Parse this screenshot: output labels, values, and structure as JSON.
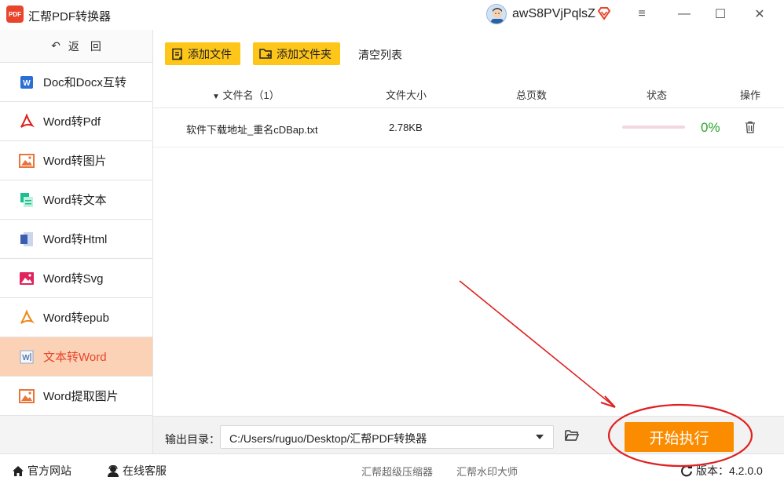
{
  "app": {
    "title": "汇帮PDF转换器",
    "logo_text": "PDF"
  },
  "user": {
    "name": "awS8PVjPqlsZ"
  },
  "window": {
    "menu": "≡",
    "minimize": "—",
    "maximize": "☐",
    "close": "✕"
  },
  "sidebar": {
    "back_label": "返　回",
    "items": [
      {
        "label": "Doc和Docx互转",
        "icon": "word-icon"
      },
      {
        "label": "Word转Pdf",
        "icon": "pdf-icon"
      },
      {
        "label": "Word转图片",
        "icon": "image-icon"
      },
      {
        "label": "Word转文本",
        "icon": "text-icon"
      },
      {
        "label": "Word转Html",
        "icon": "html-icon"
      },
      {
        "label": "Word转Svg",
        "icon": "svg-icon"
      },
      {
        "label": "Word转epub",
        "icon": "epub-icon"
      },
      {
        "label": "文本转Word",
        "icon": "text-to-word-icon",
        "active": true
      },
      {
        "label": "Word提取图片",
        "icon": "extract-image-icon"
      }
    ]
  },
  "toolbar": {
    "add_file": "添加文件",
    "add_folder": "添加文件夹",
    "clear_list": "清空列表"
  },
  "table": {
    "headers": {
      "filename": "文件名（1）",
      "size": "文件大小",
      "pages": "总页数",
      "status": "状态",
      "action": "操作"
    },
    "rows": [
      {
        "filename": "软件下载地址_重名cDBap.txt",
        "size": "2.78KB",
        "pages": "",
        "progress": 0,
        "percent": "0%"
      }
    ]
  },
  "output": {
    "label": "输出目录：",
    "path": "C:/Users/ruguo/Desktop/汇帮PDF转换器",
    "start": "开始执行"
  },
  "footer": {
    "website": "官方网站",
    "support": "在线客服",
    "link1": "汇帮超级压缩器",
    "link2": "汇帮水印大师",
    "version": "版本：4.2.0.0"
  },
  "colors": {
    "accent": "#e8452c",
    "button": "#ffc61a",
    "start": "#fb8c00",
    "active_bg": "#fbd2b6",
    "progress": "#2aa52a"
  }
}
